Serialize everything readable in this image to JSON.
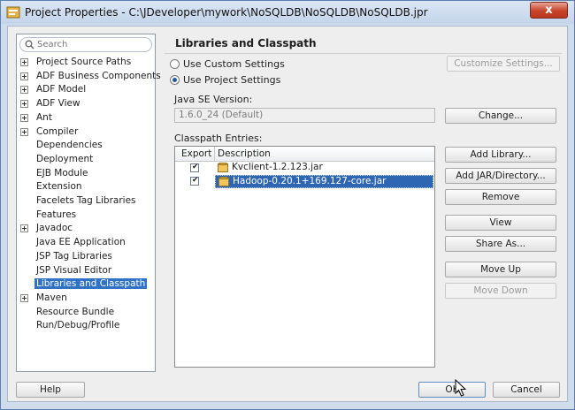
{
  "window": {
    "title": "Project Properties - C:\\JDeveloper\\mywork\\NoSQLDB\\NoSQLDB\\NoSQLDB.jpr",
    "close_glyph": "x"
  },
  "search": {
    "placeholder": "Search"
  },
  "tree": [
    {
      "label": "Project Source Paths",
      "expandable": true,
      "selected": false
    },
    {
      "label": "ADF Business Components",
      "expandable": true,
      "selected": false
    },
    {
      "label": "ADF Model",
      "expandable": true,
      "selected": false
    },
    {
      "label": "ADF View",
      "expandable": true,
      "selected": false
    },
    {
      "label": "Ant",
      "expandable": true,
      "selected": false
    },
    {
      "label": "Compiler",
      "expandable": true,
      "selected": false
    },
    {
      "label": "Dependencies",
      "expandable": false,
      "selected": false
    },
    {
      "label": "Deployment",
      "expandable": false,
      "selected": false
    },
    {
      "label": "EJB Module",
      "expandable": false,
      "selected": false
    },
    {
      "label": "Extension",
      "expandable": false,
      "selected": false
    },
    {
      "label": "Facelets Tag Libraries",
      "expandable": false,
      "selected": false
    },
    {
      "label": "Features",
      "expandable": false,
      "selected": false
    },
    {
      "label": "Javadoc",
      "expandable": true,
      "selected": false
    },
    {
      "label": "Java EE Application",
      "expandable": false,
      "selected": false
    },
    {
      "label": "JSP Tag Libraries",
      "expandable": false,
      "selected": false
    },
    {
      "label": "JSP Visual Editor",
      "expandable": false,
      "selected": false
    },
    {
      "label": "Libraries and Classpath",
      "expandable": false,
      "selected": true
    },
    {
      "label": "Maven",
      "expandable": true,
      "selected": false
    },
    {
      "label": "Resource Bundle",
      "expandable": false,
      "selected": false
    },
    {
      "label": "Run/Debug/Profile",
      "expandable": false,
      "selected": false
    }
  ],
  "panel": {
    "title": "Libraries and Classpath",
    "radio_custom": "Use Custom Settings",
    "radio_project": "Use Project Settings",
    "customize_button": "Customize Settings...",
    "java_se_label": "Java SE Version:",
    "java_se_value": "1.6.0_24 (Default)",
    "change_button": "Change...",
    "classpath_label": "Classpath Entries:",
    "table_headers": {
      "export": "Export",
      "description": "Description"
    },
    "entries": [
      {
        "export": true,
        "description": "Kvclient-1.2.123.jar",
        "selected": false
      },
      {
        "export": true,
        "description": "Hadoop-0.20.1+169.127-core.jar",
        "selected": true
      }
    ],
    "checkmark": "✔",
    "buttons": {
      "add_library": "Add Library...",
      "add_jar": "Add JAR/Directory...",
      "remove": "Remove",
      "view": "View",
      "share_as": "Share As...",
      "move_up": "Move Up",
      "move_down": "Move Down"
    }
  },
  "footer": {
    "help": "Help",
    "ok": "OK",
    "cancel": "Cancel"
  },
  "colors": {
    "selection": "#3072c5",
    "title_bar": "#c3d4ea",
    "close_button": "#c7432a"
  }
}
